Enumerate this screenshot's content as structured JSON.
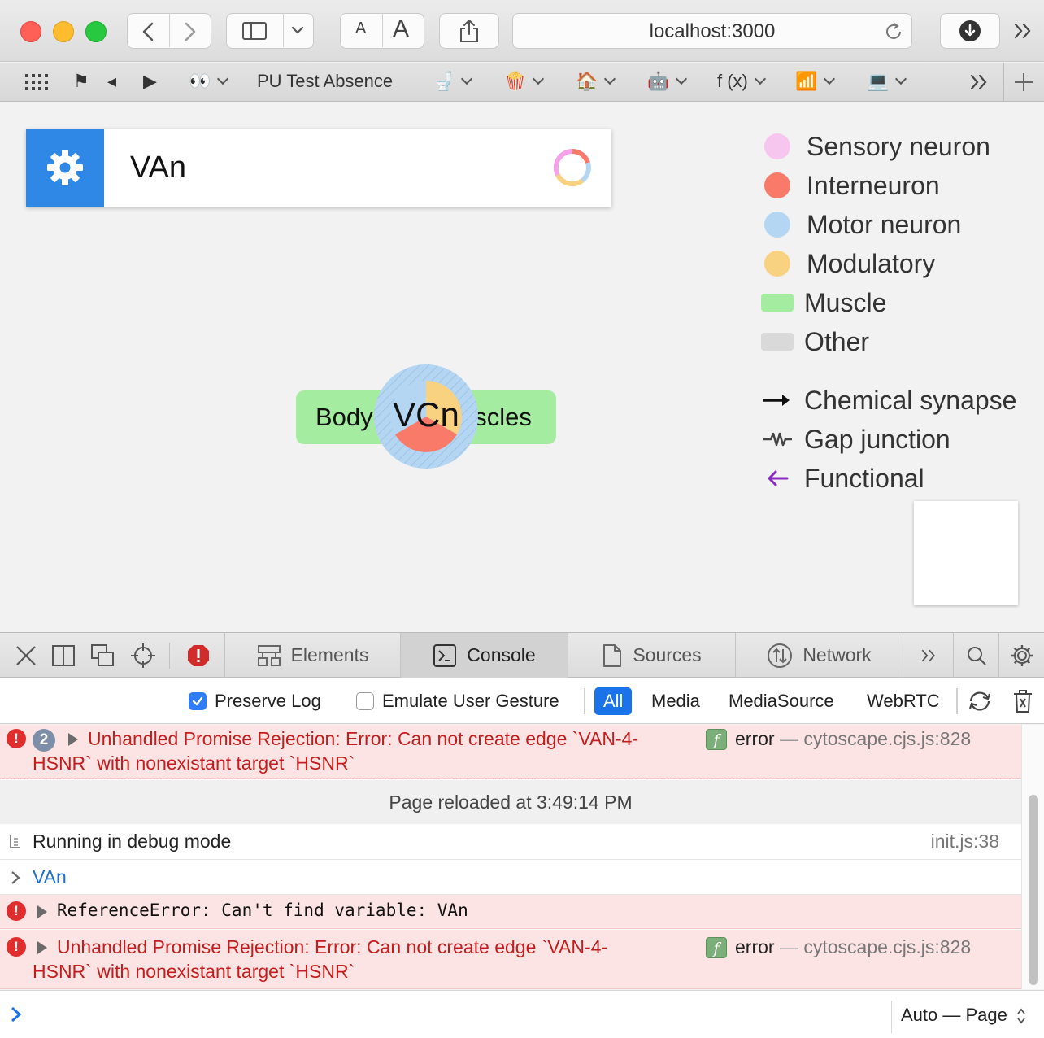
{
  "browser": {
    "url": "localhost:3000",
    "text_size_small": "A",
    "text_size_large": "A",
    "favorites": [
      {
        "name": "grid-apps",
        "label": ""
      },
      {
        "name": "flag",
        "label": "⚑"
      },
      {
        "name": "speaker",
        "label": "◂"
      },
      {
        "name": "play",
        "label": "▶"
      },
      {
        "name": "eyes",
        "label": "👀"
      },
      {
        "name": "pu-test-absence",
        "label": "PU Test Absence"
      },
      {
        "name": "toilet",
        "label": "🚽"
      },
      {
        "name": "popcorn",
        "label": "🍿"
      },
      {
        "name": "house",
        "label": "🏠"
      },
      {
        "name": "robot",
        "label": "🤖"
      },
      {
        "name": "fx",
        "label": "f (x)"
      },
      {
        "name": "chart",
        "label": "📶"
      },
      {
        "name": "laptop",
        "label": "💻"
      }
    ]
  },
  "app": {
    "search_value": "VAn",
    "legend": [
      {
        "label": "Sensory neuron",
        "color": "#f6c6ef",
        "shape": "dot"
      },
      {
        "label": "Interneuron",
        "color": "#fa7a6a",
        "shape": "dot"
      },
      {
        "label": "Motor neuron",
        "color": "#b4d6f2",
        "shape": "dot"
      },
      {
        "label": "Modulatory",
        "color": "#f8d280",
        "shape": "dot"
      },
      {
        "label": "Muscle",
        "color": "#a4eda0",
        "shape": "rect"
      },
      {
        "label": "Other",
        "color": "#d9d9d9",
        "shape": "rect"
      },
      {
        "label": "Chemical synapse",
        "color": "#111111",
        "shape": "arrow"
      },
      {
        "label": "Gap junction",
        "color": "#444444",
        "shape": "zigzag"
      },
      {
        "label": "Functional",
        "color": "#8a2cc4",
        "shape": "back-arrow"
      }
    ],
    "graph": {
      "muscle_node_label": "Body wall muscles",
      "muscle_node_visible_left": "Body",
      "muscle_node_visible_right": "uscles",
      "neuron_node_label": "VCn"
    }
  },
  "devtools": {
    "tabs": [
      {
        "label": "Elements",
        "active": false
      },
      {
        "label": "Console",
        "active": true
      },
      {
        "label": "Sources",
        "active": false
      },
      {
        "label": "Network",
        "active": false
      }
    ],
    "filters": {
      "preserve_log": "Preserve Log",
      "preserve_log_checked": true,
      "emulate_gesture": "Emulate User Gesture",
      "emulate_gesture_checked": false,
      "types": [
        "All",
        "Media",
        "MediaSource",
        "WebRTC"
      ],
      "active_type": "All"
    },
    "messages": {
      "first_error": {
        "count": "2",
        "text": "Unhandled Promise Rejection: Error: Can not create edge `VAN-4-HSNR` with nonexistant target `HSNR`",
        "line1": "Unhandled Promise Rejection: Error: Can not create edge `VAN-4-",
        "line2": "HSNR` with nonexistant target `HSNR`",
        "level": "error",
        "source": "cytoscape.cjs.js:828"
      },
      "reload_notice": "Page reloaded at 3:49:14 PM",
      "debug_log": {
        "text": "Running in debug mode",
        "source": "init.js:38"
      },
      "input_echo": "VAn",
      "reference_error": "ReferenceError: Can't find variable: VAn",
      "last_error": {
        "line1": "Unhandled Promise Rejection: Error: Can not create edge `VAN-4-",
        "line2": "HSNR` with nonexistant target `HSNR`",
        "level": "error",
        "source": "cytoscape.cjs.js:828"
      }
    },
    "execution_context": "Auto — Page"
  }
}
